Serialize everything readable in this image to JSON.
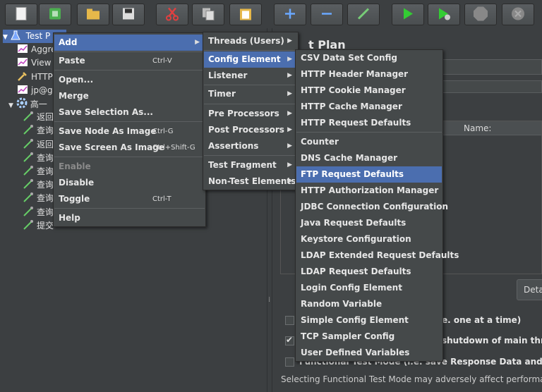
{
  "toolbar": {
    "buttons": [
      {
        "name": "new-icon",
        "color": "#f2f2f2"
      },
      {
        "name": "templates-icon",
        "color": "#4caf50"
      },
      {
        "name": "open-icon",
        "color": "#e6b84a"
      },
      {
        "name": "save-icon",
        "color": "#dddddd"
      },
      {
        "name": "cut-icon",
        "color": "#e04040"
      },
      {
        "name": "copy-icon",
        "color": "#dddddd"
      },
      {
        "name": "paste-icon",
        "color": "#e6b84a"
      },
      {
        "name": "expand-icon",
        "color": "#6aa8ff"
      },
      {
        "name": "collapse-icon",
        "color": "#6aa8ff"
      },
      {
        "name": "toggle-icon",
        "color": "#77cc77"
      },
      {
        "name": "start-icon",
        "color": "#33cc33"
      },
      {
        "name": "start-no-pause-icon",
        "color": "#33cc33"
      },
      {
        "name": "stop-icon",
        "color": "#888888"
      },
      {
        "name": "shutdown-icon",
        "color": "#888888"
      }
    ]
  },
  "tree": {
    "items": [
      {
        "label": "Test P",
        "icon": "flask-icon",
        "indent": 0
      },
      {
        "label": "Aggre",
        "icon": "chart-icon",
        "indent": 1
      },
      {
        "label": "View",
        "icon": "chart-icon",
        "indent": 1
      },
      {
        "label": "HTTP",
        "icon": "wrench-icon",
        "indent": 1
      },
      {
        "label": "jp@g",
        "icon": "chart-icon",
        "indent": 1
      },
      {
        "label": "高一",
        "icon": "gear-icon",
        "indent": 1
      },
      {
        "label": "返回",
        "icon": "pipette-icon",
        "indent": 2
      },
      {
        "label": "查询",
        "icon": "pipette-icon",
        "indent": 2
      },
      {
        "label": "返回",
        "icon": "pipette-icon",
        "indent": 2
      },
      {
        "label": "查询",
        "icon": "pipette-icon",
        "indent": 2
      },
      {
        "label": "查询",
        "icon": "pipette-icon",
        "indent": 2
      },
      {
        "label": "查询",
        "icon": "pipette-icon",
        "indent": 2
      },
      {
        "label": "查询",
        "icon": "pipette-icon",
        "indent": 2
      },
      {
        "label": "查询",
        "icon": "pipette-icon",
        "indent": 2
      },
      {
        "label": "提交",
        "icon": "pipette-icon",
        "indent": 2
      }
    ]
  },
  "right_panel": {
    "title": "t Plan",
    "table_name_header": "Name:",
    "detail_button": "Deta",
    "option1": "e. one at a time)",
    "option2": "shutdown of main threads",
    "option3": "Functional Test Mode (i.e. save Response Data and Sampler D",
    "footer": "Selecting Functional Test Mode may adversely affect performance."
  },
  "context_menu": {
    "items": [
      {
        "label": "Add",
        "submenu": true,
        "selected": true
      },
      {
        "label": "Paste",
        "shortcut": "Ctrl-V"
      },
      {
        "label": "Open..."
      },
      {
        "label": "Merge"
      },
      {
        "label": "Save Selection As..."
      },
      {
        "label": "Save Node As Image",
        "shortcut": "Ctrl-G"
      },
      {
        "label": "Save Screen As Image",
        "shortcut": "Ctrl+Shift-G"
      },
      {
        "label": "Enable",
        "disabled": true
      },
      {
        "label": "Disable"
      },
      {
        "label": "Toggle",
        "shortcut": "Ctrl-T"
      },
      {
        "label": "Help"
      }
    ]
  },
  "add_menu": {
    "items": [
      {
        "label": "Threads (Users)"
      },
      {
        "label": "Config Element",
        "selected": true
      },
      {
        "label": "Listener"
      },
      {
        "label": "Timer"
      },
      {
        "label": "Pre Processors"
      },
      {
        "label": "Post Processors"
      },
      {
        "label": "Assertions"
      },
      {
        "label": "Test Fragment"
      },
      {
        "label": "Non-Test Elements"
      }
    ]
  },
  "config_menu": {
    "items": [
      {
        "label": "CSV Data Set Config"
      },
      {
        "label": "HTTP Header Manager"
      },
      {
        "label": "HTTP Cookie Manager"
      },
      {
        "label": "HTTP Cache Manager"
      },
      {
        "label": "HTTP Request Defaults"
      },
      {
        "label": "Counter"
      },
      {
        "label": "DNS Cache Manager"
      },
      {
        "label": "FTP Request Defaults",
        "selected": true
      },
      {
        "label": "HTTP Authorization Manager"
      },
      {
        "label": "JDBC Connection Configuration"
      },
      {
        "label": "Java Request Defaults"
      },
      {
        "label": "Keystore Configuration"
      },
      {
        "label": "LDAP Extended Request Defaults"
      },
      {
        "label": "LDAP Request Defaults"
      },
      {
        "label": "Login Config Element"
      },
      {
        "label": "Random Variable"
      },
      {
        "label": "Simple Config Element"
      },
      {
        "label": "TCP Sampler Config"
      },
      {
        "label": "User Defined Variables"
      }
    ]
  },
  "colors": {
    "selection": "#4b6eaf",
    "background": "#3c3f41",
    "menu": "#45494a"
  }
}
